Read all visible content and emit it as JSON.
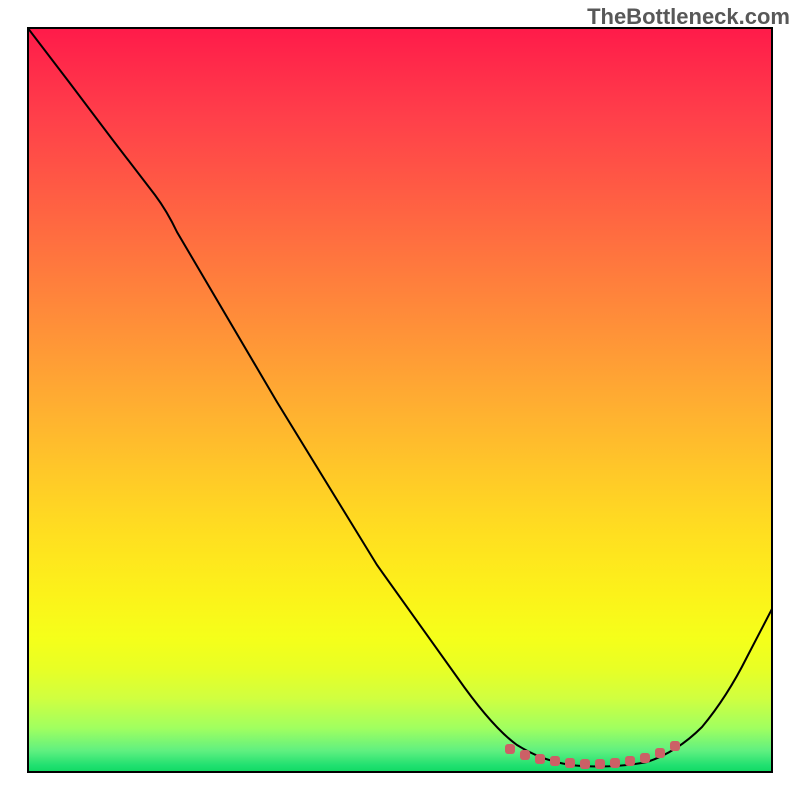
{
  "watermark": "TheBottleneck.com",
  "chart_data": {
    "type": "line",
    "title": "",
    "xlabel": "",
    "ylabel": "",
    "xlim": [
      0,
      100
    ],
    "ylim": [
      0,
      100
    ],
    "grid": false,
    "legend": false,
    "series": [
      {
        "name": "bottleneck-curve",
        "color": "#000000",
        "x": [
          0,
          5,
          10,
          15,
          20,
          25,
          30,
          35,
          40,
          45,
          50,
          55,
          60,
          63,
          67,
          70,
          73,
          76,
          79,
          82,
          85,
          88,
          91,
          94,
          97,
          100
        ],
        "y": [
          100,
          93,
          86,
          79,
          71,
          63,
          56,
          49,
          42,
          35,
          28,
          21,
          15,
          10,
          6,
          3.5,
          2,
          1,
          1,
          1,
          1.5,
          3,
          6,
          10.5,
          16,
          22
        ]
      },
      {
        "name": "optimal-range-markers",
        "color": "#cc6066",
        "x": [
          65,
          67,
          69,
          71,
          73,
          75,
          77,
          79,
          81,
          83,
          85,
          87
        ],
        "y": [
          3,
          2.3,
          1.8,
          1.5,
          1.3,
          1.2,
          1.2,
          1.3,
          1.5,
          1.9,
          2.5,
          3.2
        ]
      }
    ],
    "gradient_background": {
      "top_color": "#ff1a4a",
      "bottom_color": "#0ed860",
      "description": "vertical gradient red-orange-yellow-green representing bottleneck severity"
    }
  }
}
